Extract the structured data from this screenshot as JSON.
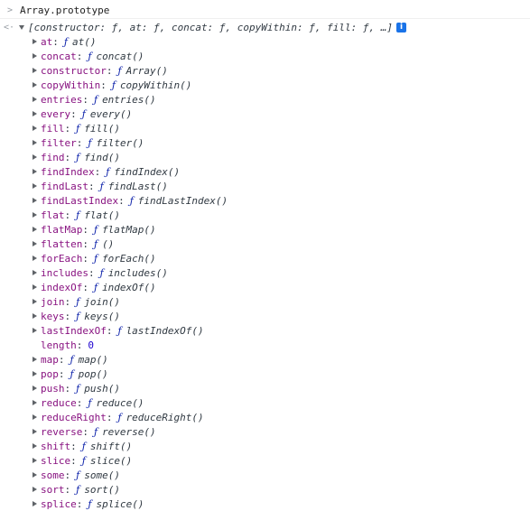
{
  "input": {
    "expression": "Array.prototype"
  },
  "result": {
    "summary": "[constructor: ƒ, at: ƒ, concat: ƒ, copyWithin: ƒ, fill: ƒ, …]",
    "info_glyph": "i"
  },
  "glyphs": {
    "function_tag": "ƒ",
    "input_prompt": ">",
    "result_prompt": "<·"
  },
  "properties": [
    {
      "key": "at",
      "value": "at()",
      "type": "function",
      "expandable": true
    },
    {
      "key": "concat",
      "value": "concat()",
      "type": "function",
      "expandable": true
    },
    {
      "key": "constructor",
      "value": "Array()",
      "type": "function",
      "expandable": true
    },
    {
      "key": "copyWithin",
      "value": "copyWithin()",
      "type": "function",
      "expandable": true
    },
    {
      "key": "entries",
      "value": "entries()",
      "type": "function",
      "expandable": true
    },
    {
      "key": "every",
      "value": "every()",
      "type": "function",
      "expandable": true
    },
    {
      "key": "fill",
      "value": "fill()",
      "type": "function",
      "expandable": true
    },
    {
      "key": "filter",
      "value": "filter()",
      "type": "function",
      "expandable": true
    },
    {
      "key": "find",
      "value": "find()",
      "type": "function",
      "expandable": true
    },
    {
      "key": "findIndex",
      "value": "findIndex()",
      "type": "function",
      "expandable": true
    },
    {
      "key": "findLast",
      "value": "findLast()",
      "type": "function",
      "expandable": true
    },
    {
      "key": "findLastIndex",
      "value": "findLastIndex()",
      "type": "function",
      "expandable": true
    },
    {
      "key": "flat",
      "value": "flat()",
      "type": "function",
      "expandable": true
    },
    {
      "key": "flatMap",
      "value": "flatMap()",
      "type": "function",
      "expandable": true
    },
    {
      "key": "flatten",
      "value": "()",
      "type": "function",
      "expandable": true
    },
    {
      "key": "forEach",
      "value": "forEach()",
      "type": "function",
      "expandable": true
    },
    {
      "key": "includes",
      "value": "includes()",
      "type": "function",
      "expandable": true
    },
    {
      "key": "indexOf",
      "value": "indexOf()",
      "type": "function",
      "expandable": true
    },
    {
      "key": "join",
      "value": "join()",
      "type": "function",
      "expandable": true
    },
    {
      "key": "keys",
      "value": "keys()",
      "type": "function",
      "expandable": true
    },
    {
      "key": "lastIndexOf",
      "value": "lastIndexOf()",
      "type": "function",
      "expandable": true
    },
    {
      "key": "length",
      "value": "0",
      "type": "number",
      "expandable": false
    },
    {
      "key": "map",
      "value": "map()",
      "type": "function",
      "expandable": true
    },
    {
      "key": "pop",
      "value": "pop()",
      "type": "function",
      "expandable": true
    },
    {
      "key": "push",
      "value": "push()",
      "type": "function",
      "expandable": true
    },
    {
      "key": "reduce",
      "value": "reduce()",
      "type": "function",
      "expandable": true
    },
    {
      "key": "reduceRight",
      "value": "reduceRight()",
      "type": "function",
      "expandable": true
    },
    {
      "key": "reverse",
      "value": "reverse()",
      "type": "function",
      "expandable": true
    },
    {
      "key": "shift",
      "value": "shift()",
      "type": "function",
      "expandable": true
    },
    {
      "key": "slice",
      "value": "slice()",
      "type": "function",
      "expandable": true
    },
    {
      "key": "some",
      "value": "some()",
      "type": "function",
      "expandable": true
    },
    {
      "key": "sort",
      "value": "sort()",
      "type": "function",
      "expandable": true
    },
    {
      "key": "splice",
      "value": "splice()",
      "type": "function",
      "expandable": true
    }
  ],
  "colors": {
    "key": "#881280",
    "function_tag": "#0d22aa",
    "number": "#1c00cf",
    "info_badge": "#1a73e8"
  }
}
